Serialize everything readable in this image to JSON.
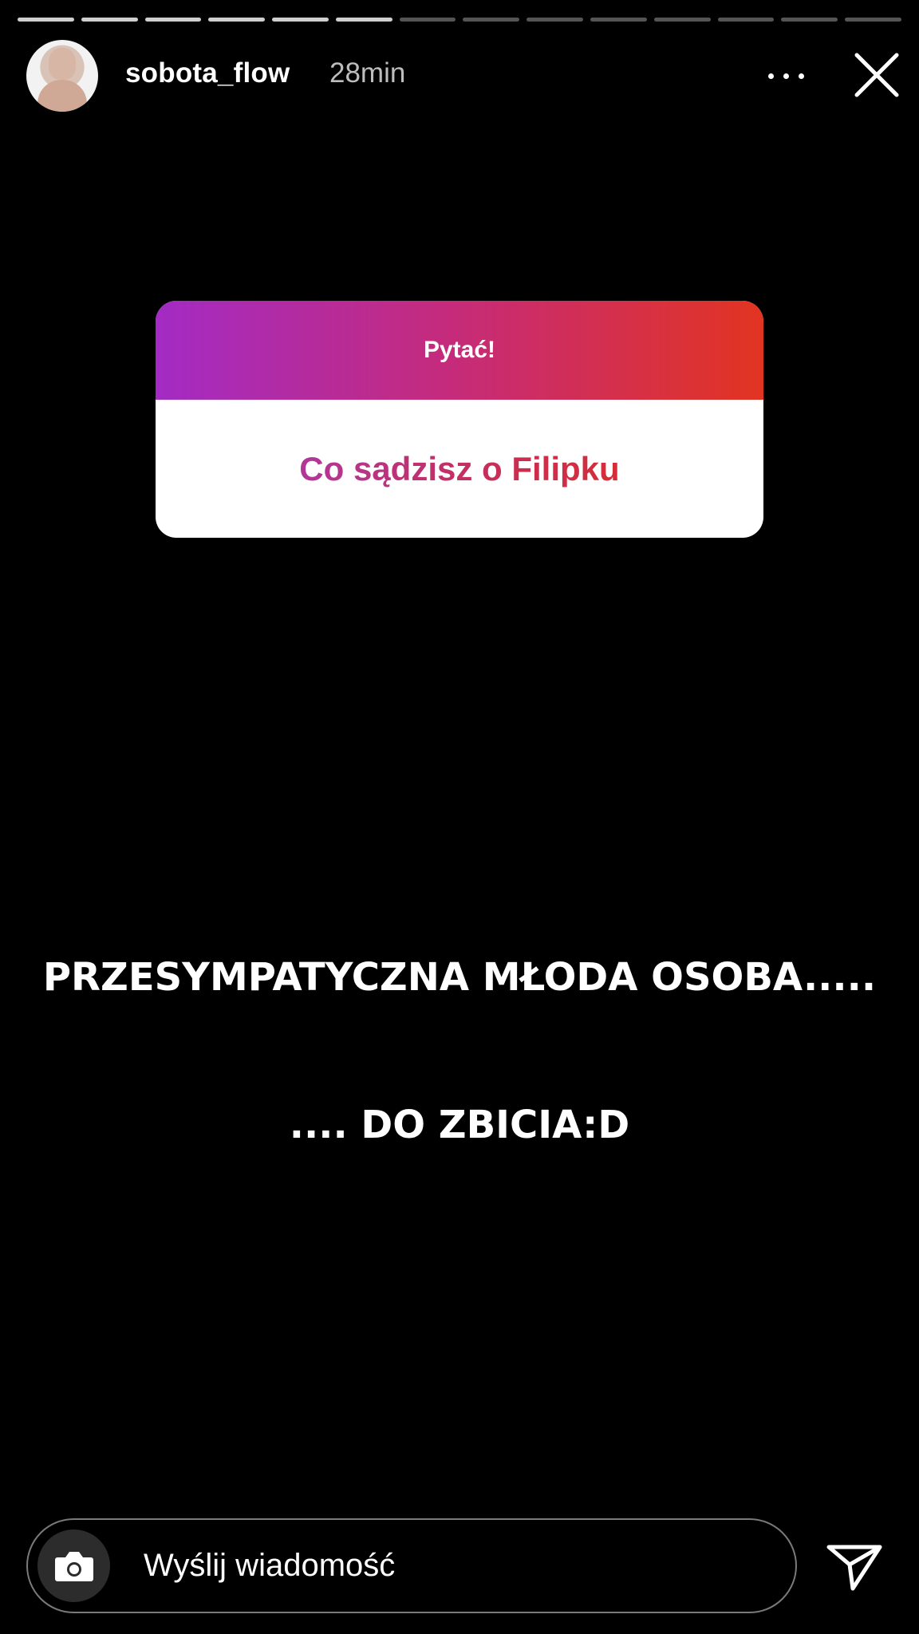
{
  "story": {
    "segments_total": 14,
    "segments_completed": 6,
    "username": "sobota_flow",
    "time": "28min"
  },
  "sticker": {
    "title": "Pytać!",
    "question": "Co sądzisz o Filipku"
  },
  "overlay": {
    "line1": "PRZESYMPATYCZNA MŁODA OSOBA.....",
    "line2": ".... DO ZBICIA:D"
  },
  "message_bar": {
    "placeholder": "Wyślij wiadomość"
  },
  "icons": {
    "camera": "camera-icon",
    "send": "send-icon",
    "more": "more-icon",
    "close": "close-icon"
  },
  "colors": {
    "sticker_gradient_start": "#a32bc4",
    "sticker_gradient_end": "#e23421",
    "background": "#000000"
  }
}
